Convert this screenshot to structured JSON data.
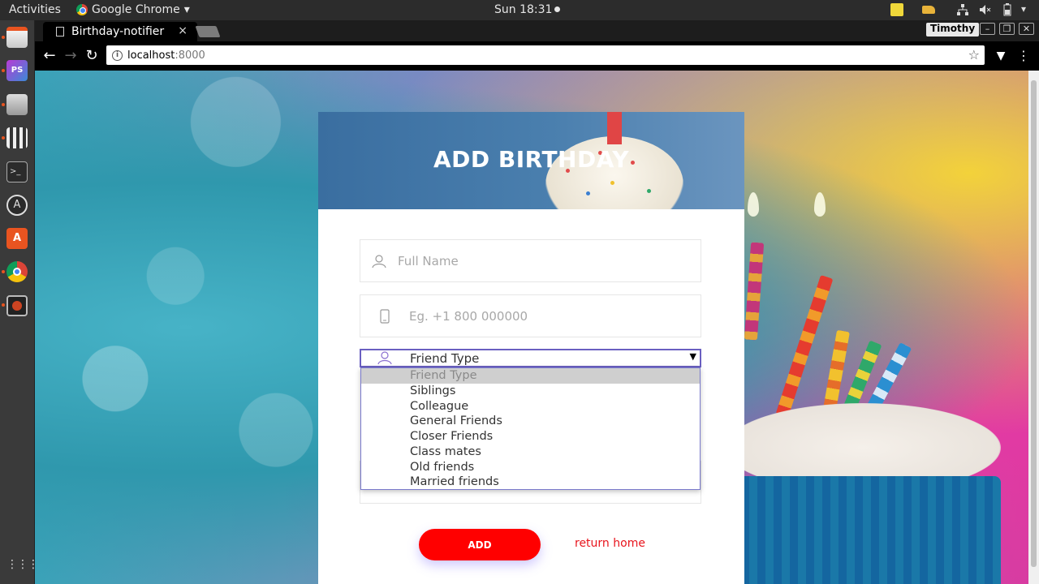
{
  "topbar": {
    "activities": "Activities",
    "app_name": "Google Chrome",
    "clock": "Sun 18:31"
  },
  "browser": {
    "tab_title": "Birthday-notifier",
    "tab_close": "×",
    "profile_name": "Timothy",
    "url_host": "localhost",
    "url_port": ":8000"
  },
  "form": {
    "title": "ADD BIRTHDAY",
    "full_name_placeholder": "Full Name",
    "phone_placeholder": "Eg. +1 800 000000",
    "friend_type": {
      "selected": "Friend Type",
      "options": [
        "Friend Type",
        "Siblings",
        "Colleague",
        "General Friends",
        "Closer Friends",
        "Class mates",
        "Old friends",
        "Married friends"
      ]
    },
    "add_label": "ADD",
    "return_home_label": "return home"
  },
  "colors": {
    "accent_button": "#ff0000",
    "link": "#e8141c",
    "select_border": "#6a5fc1",
    "header_blue": "#3a6ea0"
  }
}
